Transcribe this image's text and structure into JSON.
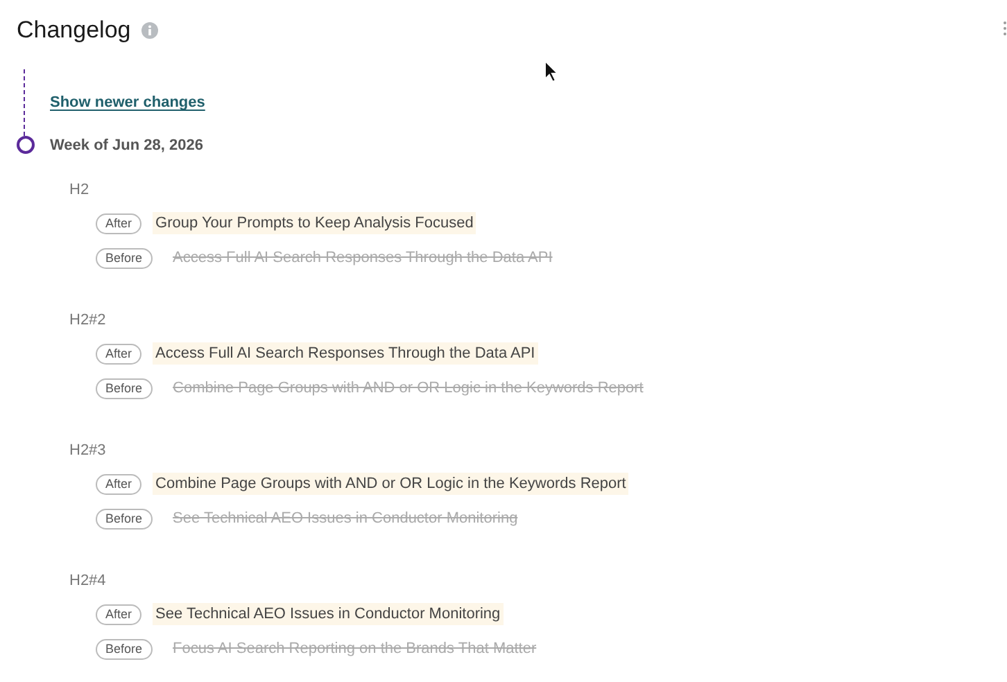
{
  "title": "Changelog",
  "show_newer_link": "Show newer changes",
  "week": "Week of Jun 28, 2026",
  "groups": [
    {
      "label": "H2",
      "entries": [
        {
          "kind": "after",
          "badge": "After",
          "text": "Group Your Prompts to Keep Analysis Focused"
        },
        {
          "kind": "before",
          "badge": "Before",
          "text": "Access Full AI Search Responses Through the Data API"
        }
      ]
    },
    {
      "label": "H2#2",
      "entries": [
        {
          "kind": "after",
          "badge": "After",
          "text": "Access Full AI Search Responses Through the Data API"
        },
        {
          "kind": "before",
          "badge": "Before",
          "text": "Combine Page Groups with AND or OR Logic in the Keywords Report"
        }
      ]
    },
    {
      "label": "H2#3",
      "entries": [
        {
          "kind": "after",
          "badge": "After",
          "text": "Combine Page Groups with AND or OR Logic in the Keywords Report"
        },
        {
          "kind": "before",
          "badge": "Before",
          "text": "See Technical AEO Issues in Conductor Monitoring"
        }
      ]
    },
    {
      "label": "H2#4",
      "entries": [
        {
          "kind": "after",
          "badge": "After",
          "text": "See Technical AEO Issues in Conductor Monitoring"
        },
        {
          "kind": "before",
          "badge": "Before",
          "text": "Focus AI Search Reporting on the Brands That Matter"
        }
      ]
    }
  ]
}
